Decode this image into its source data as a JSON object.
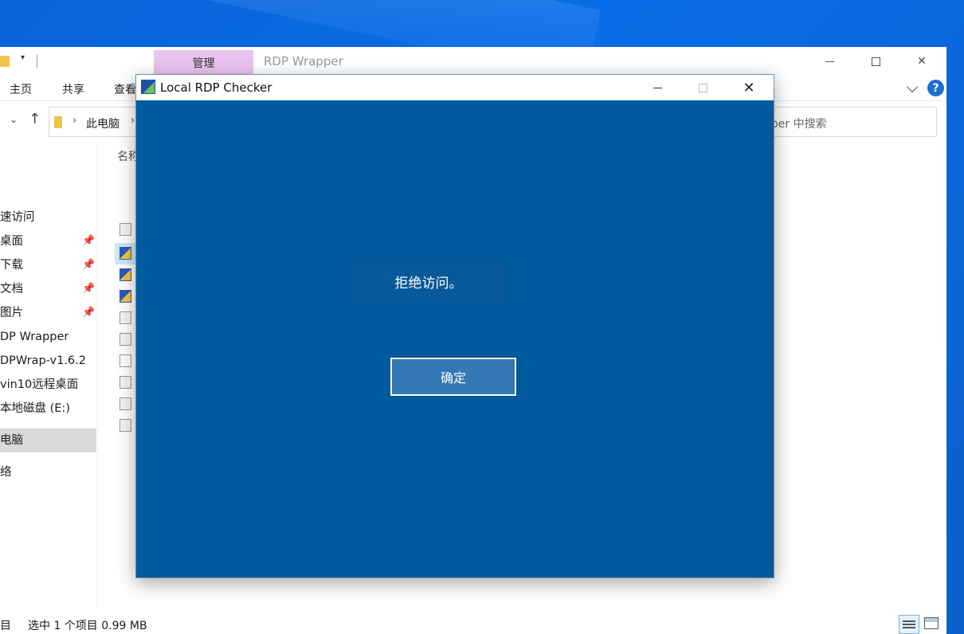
{
  "explorer": {
    "ribbon_manage_tab": "管理",
    "window_title": "RDP Wrapper",
    "tabs": [
      "主页",
      "共享",
      "查看"
    ],
    "help": "?",
    "address": {
      "crumb": "此电脑",
      "search_placeholder": "pper 中搜索"
    },
    "nav_items": [
      {
        "label": "速访问",
        "pinned": false
      },
      {
        "label": "桌面",
        "pinned": true
      },
      {
        "label": "下载",
        "pinned": true
      },
      {
        "label": "文档",
        "pinned": true
      },
      {
        "label": "图片",
        "pinned": true
      },
      {
        "label": "DP Wrapper",
        "pinned": false
      },
      {
        "label": "DPWrap-v1.6.2",
        "pinned": false
      },
      {
        "label": "vin10远程桌面",
        "pinned": false
      },
      {
        "label": "本地磁盘 (E:)",
        "pinned": false
      },
      {
        "label": "电脑",
        "pinned": false
      },
      {
        "label": "络",
        "pinned": false
      }
    ],
    "file_column_header": "名称",
    "status": {
      "items": "目",
      "selected": "选中 1 个项目  0.99 MB"
    }
  },
  "dialog": {
    "title": "Local RDP Checker",
    "message": "拒绝访问。",
    "ok_label": "确定"
  },
  "colors": {
    "dialog_bg": "#005a9e",
    "ok_button_bg": "#3278b4",
    "manage_tab_bg": "#eac2f0",
    "desktop_bg": "#0a63d8"
  }
}
